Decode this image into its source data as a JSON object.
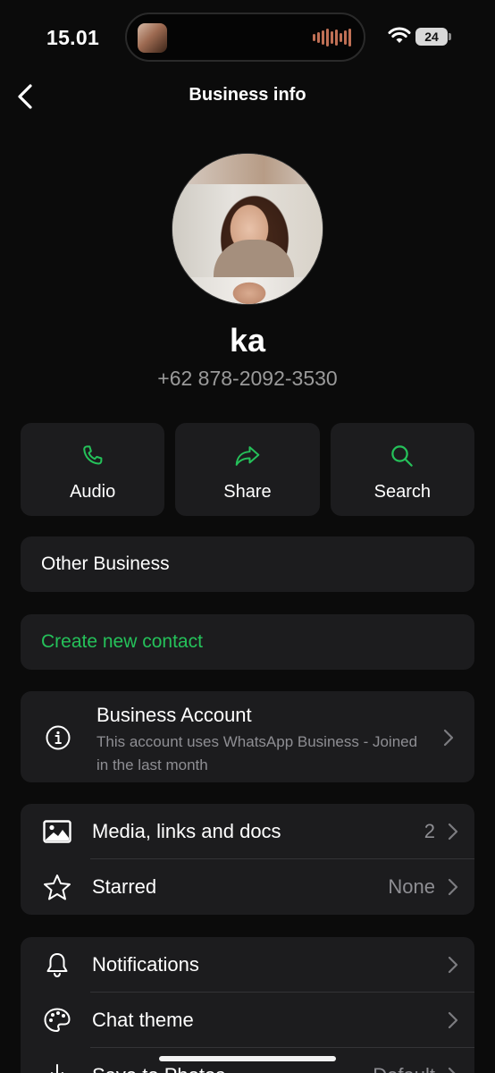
{
  "status_bar": {
    "time": "15.01",
    "battery": "24"
  },
  "nav": {
    "title": "Business info"
  },
  "profile": {
    "name": "ka",
    "phone": "+62 878-2092-3530"
  },
  "actions": [
    {
      "label": "Audio",
      "icon": "phone-icon"
    },
    {
      "label": "Share",
      "icon": "share-arrow-icon"
    },
    {
      "label": "Search",
      "icon": "search-icon"
    }
  ],
  "other_business": {
    "label": "Other Business"
  },
  "create_contact": {
    "label": "Create new contact"
  },
  "business_account": {
    "title": "Business Account",
    "subtitle": "This account uses WhatsApp Business - Joined in the last month"
  },
  "media_section": {
    "rows": [
      {
        "label": "Media, links and docs",
        "value": "2",
        "icon": "image-icon"
      },
      {
        "label": "Starred",
        "value": "None",
        "icon": "star-icon"
      }
    ]
  },
  "settings_section": {
    "rows": [
      {
        "label": "Notifications",
        "value": "",
        "icon": "bell-icon"
      },
      {
        "label": "Chat theme",
        "value": "",
        "icon": "palette-icon"
      },
      {
        "label": "Save to Photos",
        "value": "Default",
        "icon": "save-download-icon"
      }
    ]
  },
  "colors": {
    "accent": "#25c15a",
    "background": "#0b0b0b",
    "card": "#1c1c1e",
    "secondary_text": "#8e8e93"
  }
}
